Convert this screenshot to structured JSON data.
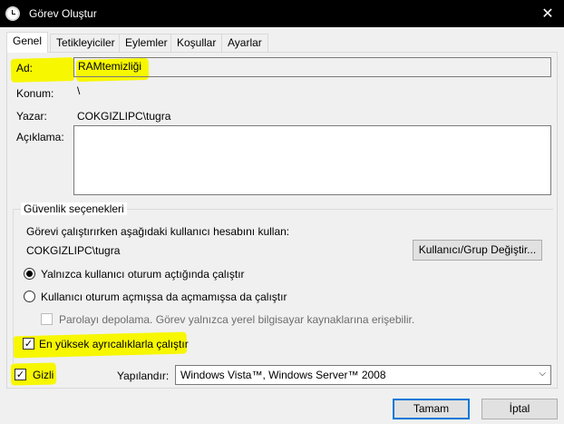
{
  "window": {
    "title": "Görev Oluştur",
    "close_glyph": "✕",
    "icon": "clock-icon"
  },
  "tabs": [
    {
      "label": "Genel",
      "active": true
    },
    {
      "label": "Tetikleyiciler"
    },
    {
      "label": "Eylemler"
    },
    {
      "label": "Koşullar"
    },
    {
      "label": "Ayarlar"
    }
  ],
  "general": {
    "name_label": "Ad:",
    "name_value": "RAMtemizliği",
    "location_label": "Konum:",
    "location_value": "\\",
    "author_label": "Yazar:",
    "author_value": "COKGIZLIPC\\tugra",
    "description_label": "Açıklama:",
    "description_value": ""
  },
  "security": {
    "title": "Güvenlik seçenekleri",
    "account_prompt": "Görevi çalıştırırken aşağıdaki kullanıcı hesabını kullan:",
    "account_value": "COKGIZLIPC\\tugra",
    "change_button": "Kullanıcı/Grup Değiştir...",
    "radio_logged_on": "Yalnızca kullanıcı oturum açtığında çalıştır",
    "radio_logged_on_checked": true,
    "radio_any": "Kullanıcı oturum açmışsa da açmamışsa da çalıştır",
    "radio_any_checked": false,
    "no_store_password": "Parolayı depolama. Görev yalnızca yerel bilgisayar kaynaklarına erişebilir.",
    "highest_privileges": "En yüksek ayrıcalıklarla çalıştır",
    "highest_privileges_checked": true
  },
  "footer": {
    "hidden_label": "Gizli",
    "hidden_checked": true,
    "configure_label": "Yapılandır:",
    "configure_value": "Windows Vista™, Windows Server™ 2008",
    "ok_button": "Tamam",
    "cancel_button": "İptal"
  },
  "check_glyph": "✓",
  "dropdown_glyph": "⌵",
  "colors": {
    "highlight": "#f7f700",
    "titlebar": "#000000",
    "focus": "#0078d7"
  }
}
